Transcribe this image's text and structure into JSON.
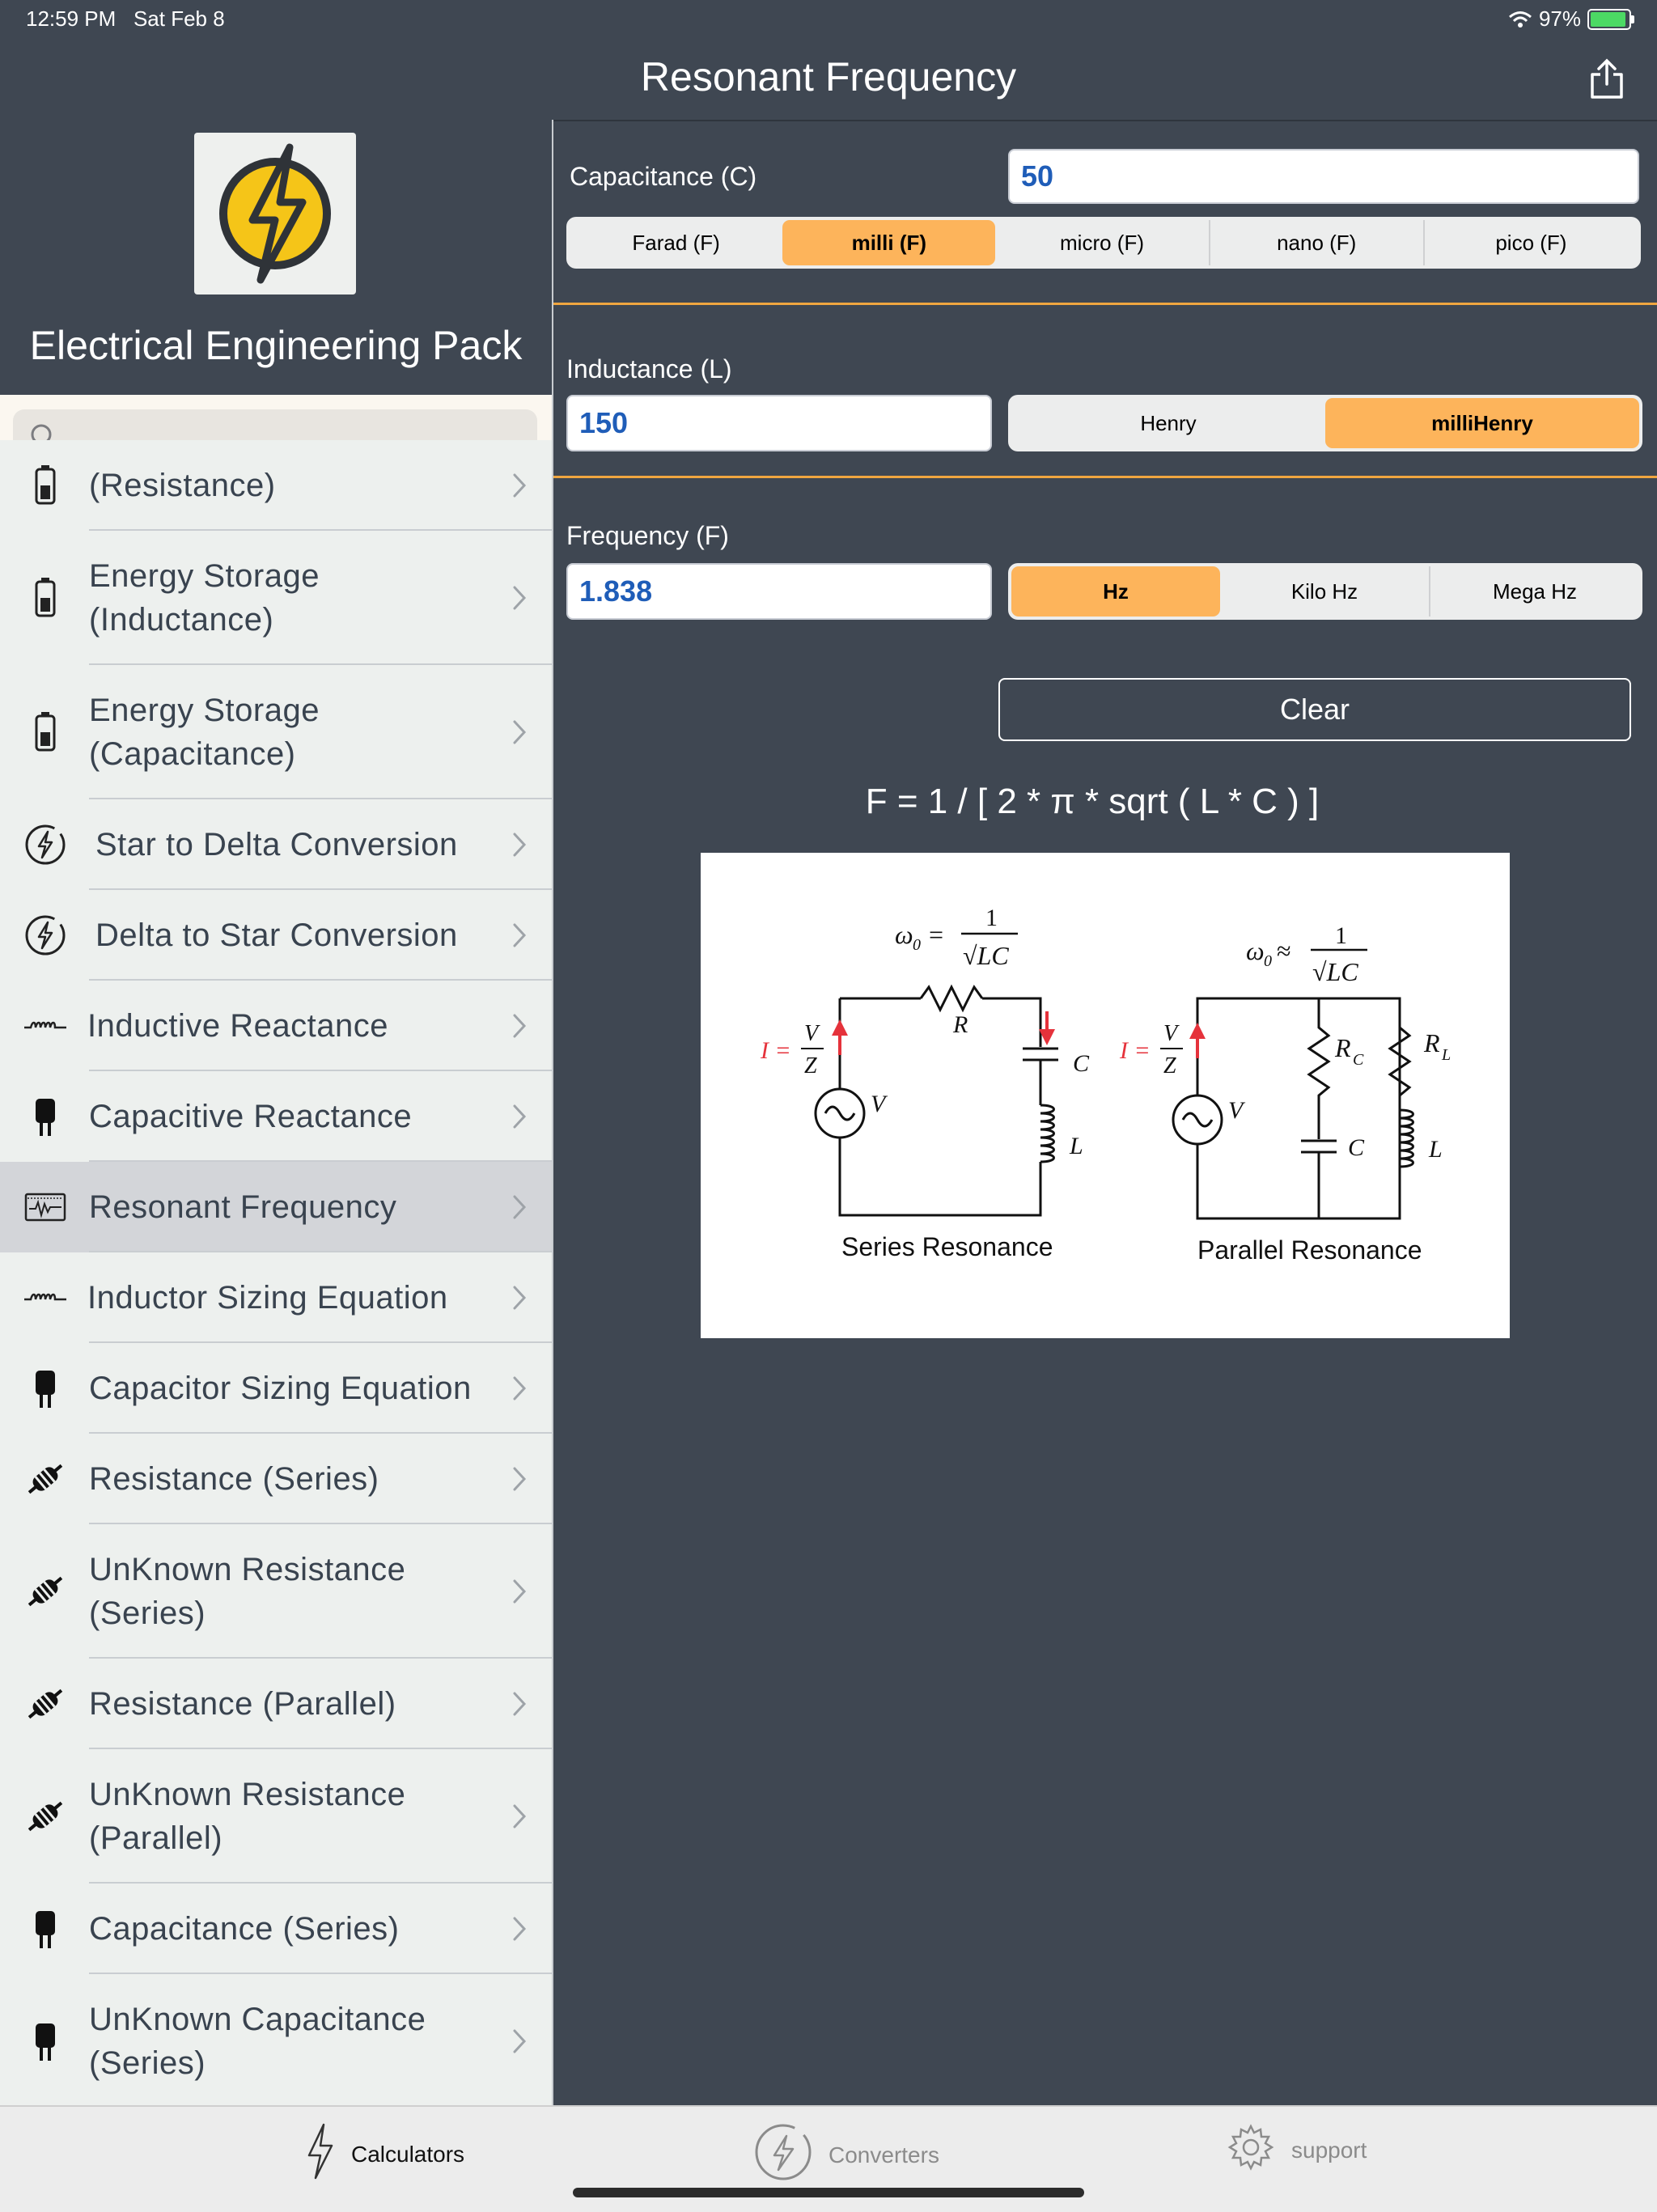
{
  "status": {
    "time": "12:59 PM",
    "date": "Sat Feb 8",
    "battery": "97%",
    "battery_level": 0.97
  },
  "nav": {
    "title": "Resonant Frequency",
    "share_icon": "share-icon"
  },
  "sidebar": {
    "brand_title": "Electrical Engineering Pack",
    "logo_icon": "lightning-bolt-icon",
    "search": {
      "placeholder": "",
      "value": ""
    },
    "items": [
      {
        "label_lines": [
          "(Resistance)"
        ],
        "icon": "battery-icon",
        "selected": false
      },
      {
        "label_lines": [
          "Energy Storage",
          "(Inductance)"
        ],
        "icon": "battery-icon",
        "selected": false
      },
      {
        "label_lines": [
          "Energy Storage",
          "(Capacitance)"
        ],
        "icon": "battery-icon",
        "selected": false
      },
      {
        "label_lines": [
          "Star to Delta Conversion"
        ],
        "icon": "bolt-circle-icon",
        "selected": false
      },
      {
        "label_lines": [
          "Delta to Star Conversion"
        ],
        "icon": "bolt-circle-icon",
        "selected": false
      },
      {
        "label_lines": [
          "Inductive Reactance"
        ],
        "icon": "inductor-icon",
        "selected": false
      },
      {
        "label_lines": [
          "Capacitive Reactance"
        ],
        "icon": "capacitor-icon",
        "selected": false
      },
      {
        "label_lines": [
          "Resonant Frequency"
        ],
        "icon": "oscilloscope-icon",
        "selected": true
      },
      {
        "label_lines": [
          "Inductor Sizing Equation"
        ],
        "icon": "inductor-icon",
        "selected": false
      },
      {
        "label_lines": [
          "Capacitor Sizing Equation"
        ],
        "icon": "capacitor-icon",
        "selected": false
      },
      {
        "label_lines": [
          "Resistance (Series)"
        ],
        "icon": "resistor-icon",
        "selected": false
      },
      {
        "label_lines": [
          "UnKnown Resistance",
          "(Series)"
        ],
        "icon": "resistor-icon",
        "selected": false
      },
      {
        "label_lines": [
          "Resistance (Parallel)"
        ],
        "icon": "resistor-icon",
        "selected": false
      },
      {
        "label_lines": [
          "UnKnown Resistance",
          "(Parallel)"
        ],
        "icon": "resistor-icon",
        "selected": false
      },
      {
        "label_lines": [
          "Capacitance (Series)"
        ],
        "icon": "capacitor-icon",
        "selected": false
      },
      {
        "label_lines": [
          "UnKnown Capacitance",
          "(Series)"
        ],
        "icon": "capacitor-icon",
        "selected": false
      }
    ]
  },
  "main": {
    "capacitance": {
      "label": "Capacitance (C)",
      "value": "50",
      "units": [
        "Farad (F)",
        "milli (F)",
        "micro (F)",
        "nano (F)",
        "pico (F)"
      ],
      "selected": 1
    },
    "inductance": {
      "label": "Inductance (L)",
      "value": "150",
      "units": [
        "Henry",
        "milliHenry"
      ],
      "selected": 1
    },
    "frequency": {
      "label": "Frequency (F)",
      "value": "1.838",
      "units": [
        "Hz",
        "Kilo Hz",
        "Mega Hz"
      ],
      "selected": 0
    },
    "clear_label": "Clear",
    "formula": "F = 1 / [ 2 * π * sqrt ( L * C ) ]",
    "diagram": {
      "series_caption": "Series Resonance",
      "parallel_caption": "Parallel Resonance",
      "w0": "ω",
      "w0_sub": "0",
      "eq": "=",
      "approx": "≈",
      "one": "1",
      "sqrt_lc": "√LC",
      "i_eq": "I =",
      "v": "V",
      "z": "Z",
      "r": "R",
      "c": "C",
      "l": "L",
      "rc": "R",
      "rc_sub": "C",
      "rl": "R",
      "rl_sub": "L"
    }
  },
  "tabs": [
    {
      "label": "Calculators",
      "icon": "lightning-icon",
      "active": true
    },
    {
      "label": "Converters",
      "icon": "bolt-circle-icon",
      "active": false
    },
    {
      "label": "support",
      "icon": "gear-icon",
      "active": false
    }
  ],
  "colors": {
    "accent": "#fdb45b",
    "divider": "#f0a640",
    "nav_bg": "#3f4752",
    "value_text": "#1f5db8"
  }
}
